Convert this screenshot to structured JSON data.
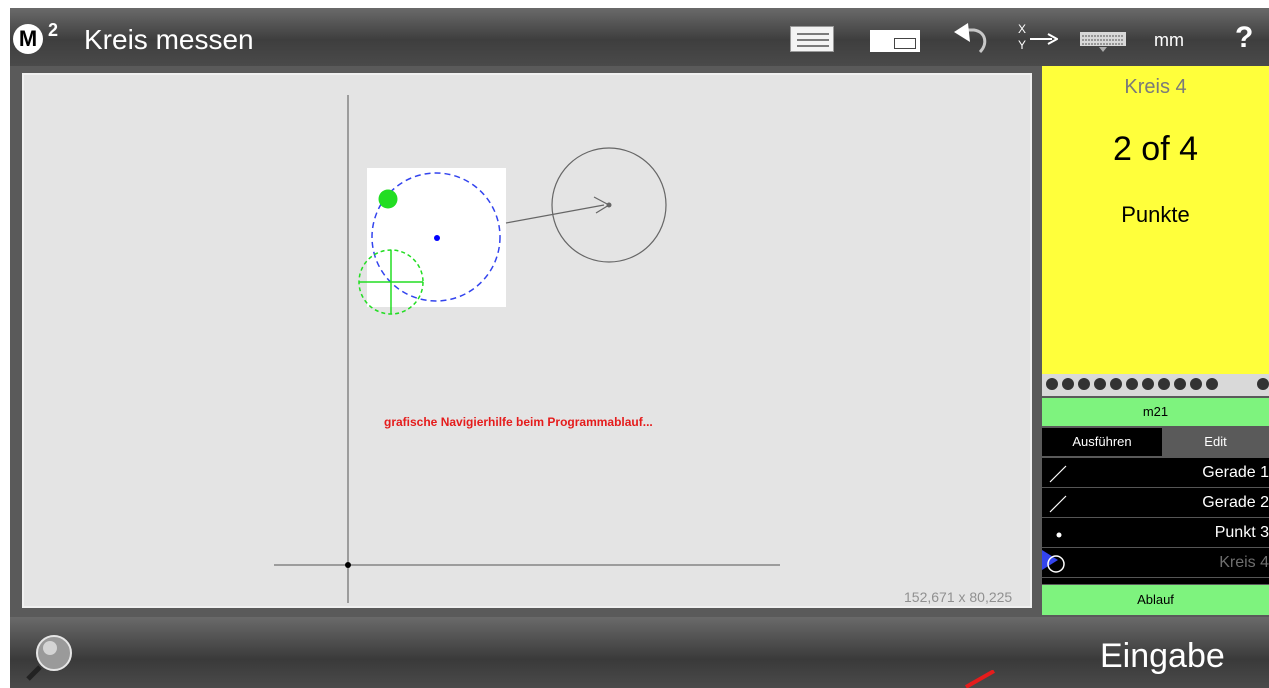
{
  "app": {
    "logo": "M",
    "logo_superscript": "2",
    "title": "Kreis messen"
  },
  "toolbar": {
    "coordinate_display_icon": "coordinate-display-icon",
    "layout_icon": "layout-toggle-icon",
    "undo_icon": "undo-icon",
    "xy_axis_label_x": "X",
    "xy_axis_label_y": "Y",
    "xy_icon": "axis-assignment-icon",
    "keyboard_icon": "keyboard-icon",
    "unit": "mm",
    "help": "?"
  },
  "viewport": {
    "annotation": "grafische Navigierhilfe beim  Programmablauf...",
    "dimensions": "152,671 x 80,225"
  },
  "info_panel": {
    "feature_title": "Kreis 4",
    "counter": "2 of 4",
    "unit_label": "Punkte",
    "background": "#ffff3b"
  },
  "program": {
    "name": "m21",
    "tabs": [
      "Ausführen",
      "Edit"
    ],
    "features": [
      {
        "label": "Gerade 1",
        "icon": "line-icon"
      },
      {
        "label": "Gerade 2",
        "icon": "line-icon"
      },
      {
        "label": "Punkt 3",
        "icon": "point-icon"
      },
      {
        "label": "Kreis 4",
        "icon": "circle-icon"
      }
    ],
    "run_button": "Ablauf"
  },
  "bottom": {
    "magnifier_icon": "magnifier-icon",
    "enter_button": "Eingabe"
  },
  "colors": {
    "accent_green": "#7ef37e",
    "annotation_red": "#e51c1c",
    "probe_green": "#22dd22",
    "path_blue": "#3344ee"
  }
}
